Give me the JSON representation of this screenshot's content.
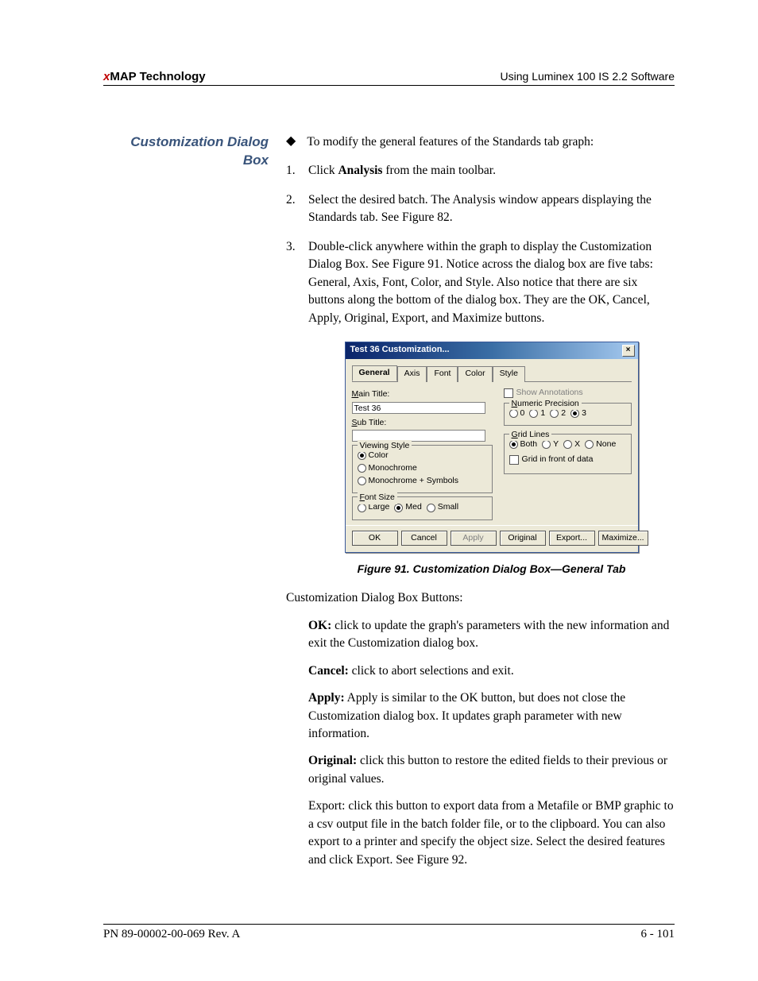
{
  "header": {
    "left_prefix": "x",
    "left_rest": "MAP Technology",
    "right": "Using Luminex 100 IS 2.2 Software"
  },
  "side_heading": "Customization Dialog Box",
  "lead": "To modify the general features of the Standards tab graph:",
  "steps": {
    "s1_a": "Click ",
    "s1_b": "Analysis",
    "s1_c": " from the main toolbar.",
    "s2": "Select the desired batch. The Analysis window appears displaying the Standards tab. See Figure 82.",
    "s3": "Double-click anywhere within the graph to display the Customization Dialog Box. See Figure 91. Notice across the dialog box are five tabs: General, Axis, Font, Color, and Style. Also notice that there are six buttons along the bottom of the dialog box. They are the OK, Cancel, Apply, Original, Export, and Maximize buttons."
  },
  "dialog": {
    "title": "Test 36 Customization...",
    "tabs": [
      "General",
      "Axis",
      "Font",
      "Color",
      "Style"
    ],
    "main_title_label": "Main Title:",
    "main_title_value": "Test 36",
    "sub_title_label": "Sub Title:",
    "sub_title_value": "",
    "viewing_style": {
      "title": "Viewing Style",
      "opts": [
        "Color",
        "Monochrome",
        "Monochrome + Symbols"
      ]
    },
    "font_size": {
      "title": "Font Size",
      "opts": [
        "Large",
        "Med",
        "Small"
      ]
    },
    "show_annotations": "Show Annotations",
    "numeric_precision": {
      "title": "Numeric Precision",
      "opts": [
        "0",
        "1",
        "2",
        "3"
      ]
    },
    "grid_lines": {
      "title": "Grid Lines",
      "opts": [
        "Both",
        "Y",
        "X",
        "None"
      ],
      "grid_in_front": "Grid in front of data"
    },
    "buttons": {
      "ok": "OK",
      "cancel": "Cancel",
      "apply": "Apply",
      "original": "Original",
      "export": "Export...",
      "maximize": "Maximize..."
    }
  },
  "figcaption": "Figure 91.  Customization Dialog Box—General Tab",
  "subsection_intro": "Customization Dialog Box Buttons:",
  "defs": {
    "ok_l": "OK:",
    "ok_t": " click to update the graph's parameters with the new information and exit the Customization dialog box.",
    "cancel_l": "Cancel:",
    "cancel_t": " click to abort selections and exit.",
    "apply_l": "Apply:",
    "apply_t": " Apply is similar to the OK button, but does not close the Customization dialog box. It updates graph parameter with new information.",
    "original_l": "Original:",
    "original_t": " click this button to restore the edited fields to their previous or original values.",
    "export_t": "Export: click this button to export data from a Metafile or BMP graphic to a csv output file in the batch folder file, or to the clipboard. You can also export to a printer and specify the object size. Select the desired features and click Export. See Figure 92."
  },
  "footer": {
    "left": "PN 89-00002-00-069 Rev. A",
    "right": "6 - 101"
  }
}
